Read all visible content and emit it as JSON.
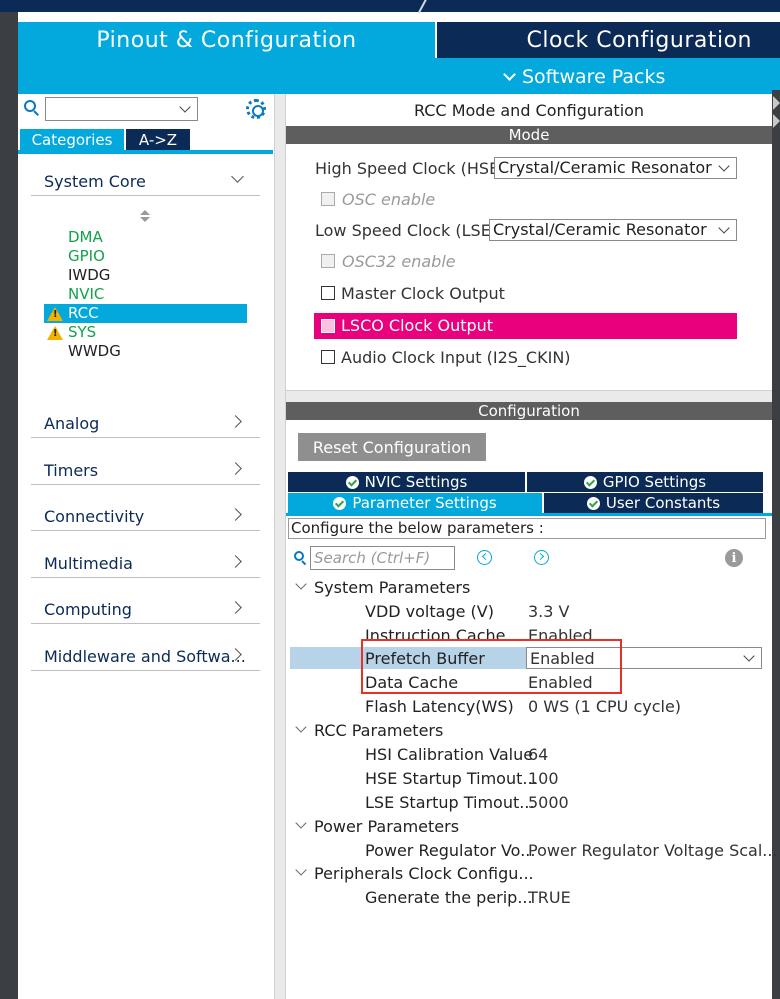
{
  "tabs": {
    "pinout": "Pinout & Configuration",
    "clock": "Clock Configuration",
    "software_packs": "Software Packs"
  },
  "left": {
    "search_value": "",
    "tab_categories": "Categories",
    "tab_az": "A->Z",
    "system_core": {
      "label": "System Core",
      "items": [
        {
          "label": "DMA",
          "color": "#12a34a",
          "warning": false
        },
        {
          "label": "GPIO",
          "color": "#12a34a",
          "warning": false
        },
        {
          "label": "IWDG",
          "color": "#222222",
          "warning": false
        },
        {
          "label": "NVIC",
          "color": "#12a34a",
          "warning": false
        },
        {
          "label": "RCC",
          "color": "#ffffff",
          "warning": true,
          "selected": true
        },
        {
          "label": "SYS",
          "color": "#12a34a",
          "warning": true
        },
        {
          "label": "WWDG",
          "color": "#222222",
          "warning": false
        }
      ]
    },
    "groups": [
      "Analog",
      "Timers",
      "Connectivity",
      "Multimedia",
      "Computing",
      "Middleware and Softwa..."
    ]
  },
  "rcc": {
    "title": "RCC Mode and Configuration",
    "mode_header": "Mode",
    "hse_label": "High Speed Clock (HSE)",
    "hse_value": "Crystal/Ceramic Resonator",
    "osc_enable": "OSC enable",
    "lse_label": "Low Speed Clock (LSE)",
    "lse_value": "Crystal/Ceramic Resonator",
    "osc32_enable": "OSC32 enable",
    "mco": "Master Clock Output",
    "lsco": "LSCO Clock Output",
    "i2s": "Audio Clock Input (I2S_CKIN)",
    "config_header": "Configuration",
    "reset_button": "Reset Configuration",
    "settings_tabs": {
      "nvic": "NVIC Settings",
      "gpio": "GPIO Settings",
      "params": "Parameter Settings",
      "user_constants": "User Constants"
    },
    "config_info": "Configure the below parameters :",
    "search_placeholder": "Search (Ctrl+F)",
    "tree": {
      "system": {
        "label": "System Parameters",
        "params": [
          {
            "name": "VDD voltage (V)",
            "value": "3.3 V"
          },
          {
            "name": "Instruction Cache",
            "value": "Enabled"
          },
          {
            "name": "Prefetch Buffer",
            "value": "Enabled"
          },
          {
            "name": "Data Cache",
            "value": "Enabled"
          },
          {
            "name": "Flash Latency(WS)",
            "value": "0 WS (1 CPU cycle)"
          }
        ]
      },
      "rcc": {
        "label": "RCC Parameters",
        "params": [
          {
            "name": "HSI Calibration Value",
            "value": "64"
          },
          {
            "name": "HSE Startup Timout...",
            "value": "100"
          },
          {
            "name": "LSE Startup Timout...",
            "value": "5000"
          }
        ]
      },
      "power": {
        "label": "Power Parameters",
        "params": [
          {
            "name": "Power Regulator Vo...",
            "value": "Power Regulator Voltage Scal..."
          }
        ]
      },
      "periph": {
        "label": "Peripherals Clock Configu...",
        "params": [
          {
            "name": "Generate the perip...",
            "value": "TRUE"
          }
        ]
      }
    }
  },
  "colors": {
    "accent": "#03a9dd",
    "navy": "#0b2a55",
    "highlight": "#e8007d",
    "annotation": "#e53228"
  }
}
